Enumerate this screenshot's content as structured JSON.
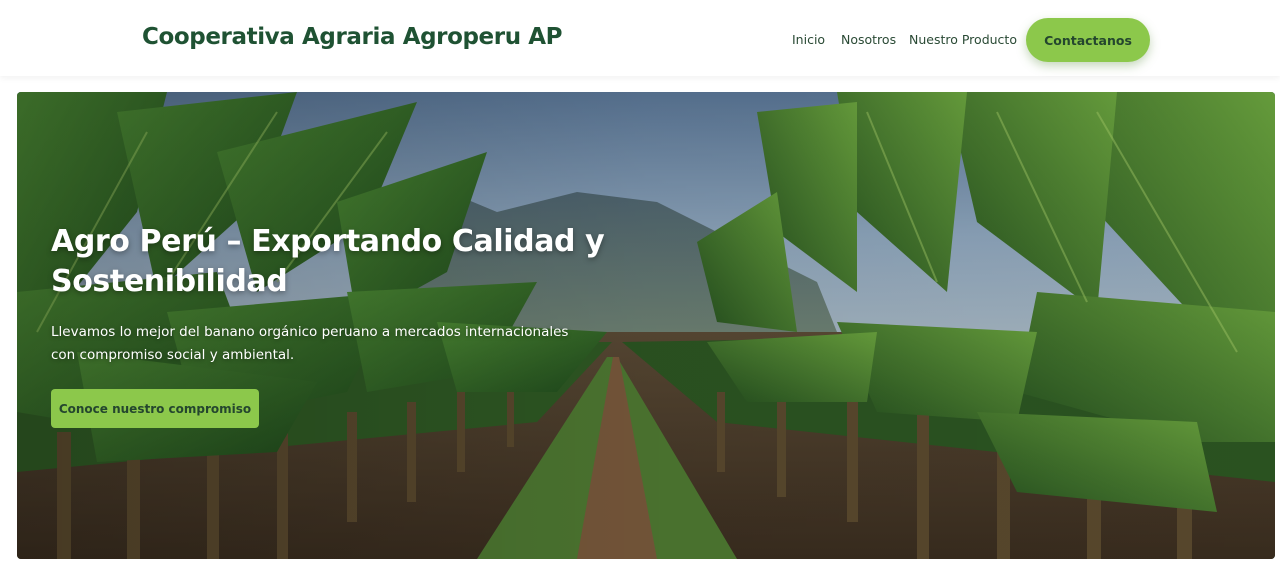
{
  "navbar": {
    "brand": "Cooperativa Agraria Agroperu AP",
    "links": [
      {
        "label": "Inicio"
      },
      {
        "label": "Nosotros"
      },
      {
        "label": "Nuestro Producto"
      }
    ],
    "cta_label": "Contactanos"
  },
  "hero": {
    "title": "Agro Perú – Exportando Calidad y Sostenibilidad",
    "description": "Llevamos lo mejor del banano orgánico peruano a mercados internacionales con compromiso social y ambiental.",
    "button_label": "Conoce nuestro compromiso",
    "background_image": "banana-plantation-photo"
  },
  "colors": {
    "brand": "#1f5233",
    "accent": "#8cc84b",
    "button_text": "#24462e"
  }
}
